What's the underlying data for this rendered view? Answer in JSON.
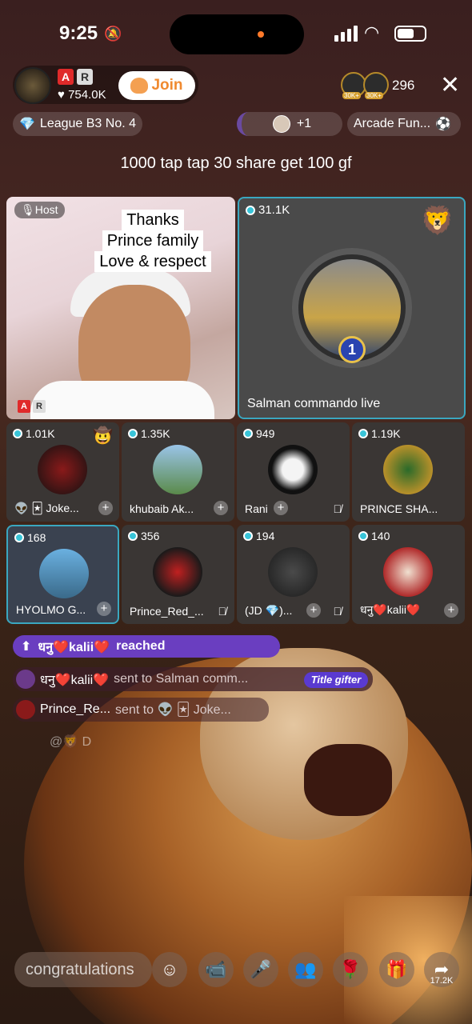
{
  "status_bar": {
    "time": "9:25"
  },
  "header": {
    "likes": "754.0K",
    "join_label": "Join",
    "viewer_badges": [
      "30K+",
      "30K+"
    ],
    "viewer_count": "296",
    "league": "League B3 No. 4",
    "plus_count": "+1",
    "arcade": "Arcade Fun..."
  },
  "announcement": "1000 tap tap 30 share get 100 gf",
  "host_tile": {
    "badge": "Host",
    "caption": [
      "Thanks",
      "Prince family",
      "Love & respect"
    ]
  },
  "guest_tile": {
    "count": "31.1K",
    "rank": "1",
    "name": "Salman commando live"
  },
  "tiles": [
    {
      "count": "1.01K",
      "name": "👽 🃏 Joke..."
    },
    {
      "count": "1.35K",
      "name": "khubaib Ak..."
    },
    {
      "count": "949",
      "name": "Rani"
    },
    {
      "count": "1.19K",
      "name": "PRINCE SHA..."
    },
    {
      "count": "168",
      "name": "HYOLMO G..."
    },
    {
      "count": "356",
      "name": "Prince_Red_..."
    },
    {
      "count": "194",
      "name": "(JD 💎)..."
    },
    {
      "count": "140",
      "name": "धनु❤️kalii❤️"
    }
  ],
  "chat": {
    "line1_name": "धनु❤️kalii❤️",
    "line1_text": "reached",
    "line2_name": "धनु❤️kalii❤️",
    "line2_text": "sent to Salman comm...",
    "line2_tag": "Title gifter",
    "line3_name": "Prince_Re...",
    "line3_text": "sent to 👽 🃏 Joke...",
    "line4": "@🦁 D"
  },
  "bottom": {
    "comment_placeholder": "congratulations",
    "share_count": "17.2K"
  }
}
